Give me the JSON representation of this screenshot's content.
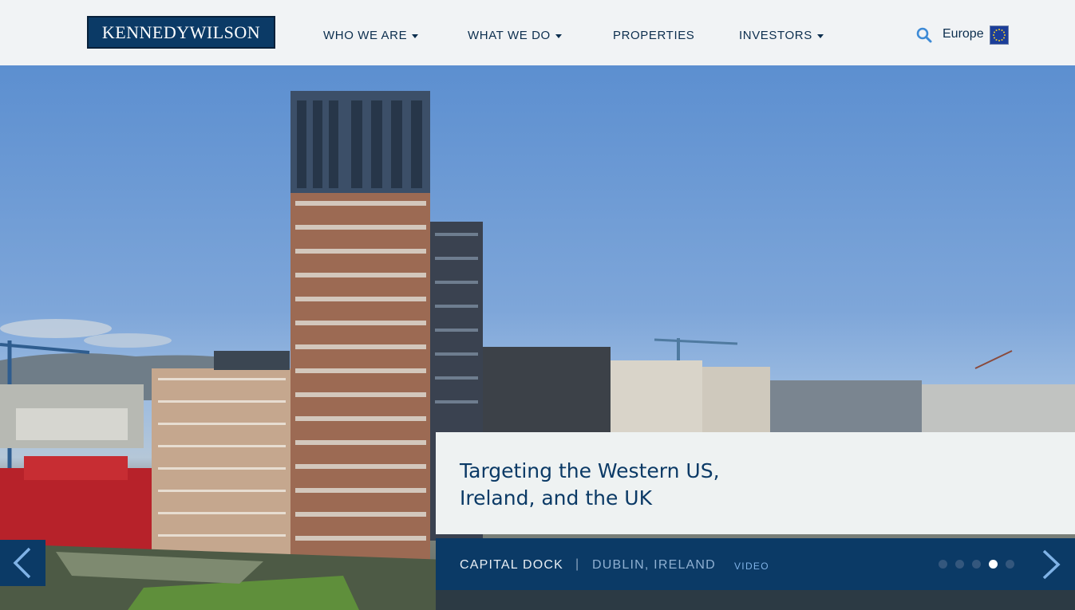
{
  "header": {
    "logo_text": "KENNEDYWILSON",
    "nav": [
      {
        "label": "WHO WE ARE",
        "dropdown": true
      },
      {
        "label": "WHAT WE DO",
        "dropdown": true
      },
      {
        "label": "PROPERTIES",
        "dropdown": false
      },
      {
        "label": "INVESTORS",
        "dropdown": true
      }
    ],
    "search_icon": "search-icon",
    "region_label": "Europe",
    "region_flag_icon": "eu-flag-icon"
  },
  "hero": {
    "headline": "Targeting the Western US, Ireland, and the UK",
    "property_name": "CAPITAL DOCK",
    "separator": "|",
    "location": "DUBLIN, IRELAND",
    "video_link": "VIDEO",
    "slides_total": 5,
    "active_slide": 4,
    "prev_icon": "chevron-left-icon",
    "next_icon": "chevron-right-icon"
  },
  "colors": {
    "brand_navy": "#0b3a66",
    "header_bg": "#f1f3f5",
    "caption_bg": "#eef2f2",
    "link_blue": "#7fb2e6"
  }
}
